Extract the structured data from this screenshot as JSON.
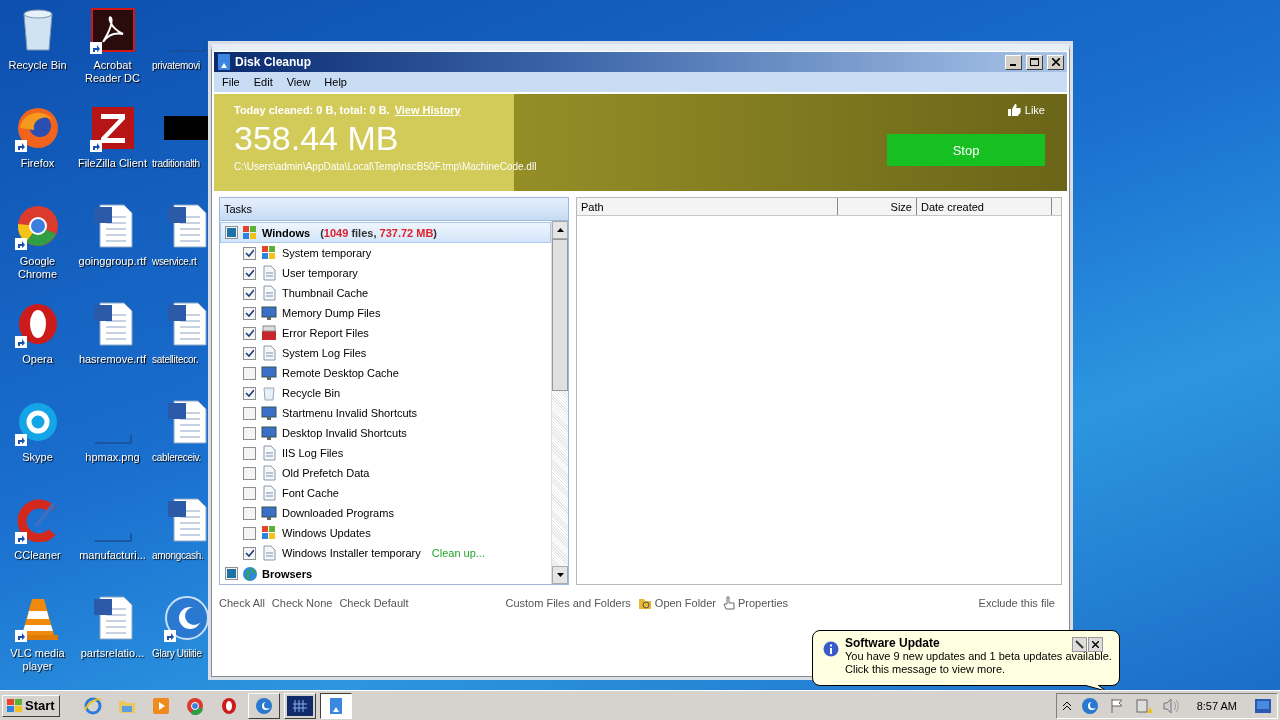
{
  "desktop": {
    "icons": [
      {
        "label": "Recycle Bin",
        "kind": "recycle",
        "shortcut": false
      },
      {
        "label": "Acrobat Reader DC",
        "kind": "acrobat",
        "shortcut": true
      },
      {
        "label": "privatemovi",
        "kind": "blank",
        "shortcut": false
      },
      {
        "label": "Firefox",
        "kind": "firefox",
        "shortcut": true
      },
      {
        "label": "FileZilla Client",
        "kind": "filezilla",
        "shortcut": true
      },
      {
        "label": "traditionalth",
        "kind": "black",
        "shortcut": false
      },
      {
        "label": "Google Chrome",
        "kind": "chrome",
        "shortcut": true
      },
      {
        "label": "goinggroup.rtf",
        "kind": "word",
        "shortcut": false
      },
      {
        "label": "wservice.rt",
        "kind": "word",
        "shortcut": false
      },
      {
        "label": "Opera",
        "kind": "opera",
        "shortcut": true
      },
      {
        "label": "hasremove.rtf",
        "kind": "word",
        "shortcut": false
      },
      {
        "label": "satellitecor.",
        "kind": "word",
        "shortcut": false
      },
      {
        "label": "Skype",
        "kind": "skype",
        "shortcut": true
      },
      {
        "label": "hpmax.png",
        "kind": "blank",
        "shortcut": false
      },
      {
        "label": "cablereceiv.",
        "kind": "word",
        "shortcut": false
      },
      {
        "label": "CCleaner",
        "kind": "ccleaner",
        "shortcut": true
      },
      {
        "label": "manufacturi...",
        "kind": "blank",
        "shortcut": false
      },
      {
        "label": "amongcash.",
        "kind": "word",
        "shortcut": false
      },
      {
        "label": "VLC media player",
        "kind": "vlc",
        "shortcut": true
      },
      {
        "label": "partsrelatio...",
        "kind": "word",
        "shortcut": false
      },
      {
        "label": "Glary Utilitie",
        "kind": "glary",
        "shortcut": true
      }
    ]
  },
  "window": {
    "title": "Disk Cleanup",
    "menu": [
      "File",
      "Edit",
      "View",
      "Help"
    ],
    "banner": {
      "summary": "Today cleaned: 0 B, total: 0 B.",
      "history_link": "View History",
      "size": "358.44 MB",
      "path": "C:\\Users\\admin\\AppData\\Local\\Temp\\nscB50F.tmp\\MachineCode.dll",
      "like": "Like",
      "button": "Stop"
    },
    "tasks": {
      "header": "Tasks",
      "groups": [
        {
          "name": "Windows",
          "kind": "flag",
          "indeterminate": true,
          "selected": true,
          "stats": [
            {
              "text": "(",
              "highlight": false
            },
            {
              "text": "1049",
              "highlight": true
            },
            {
              "text": " files, ",
              "highlight": false
            },
            {
              "text": "737.72 MB",
              "highlight": true
            },
            {
              "text": ")",
              "highlight": false
            }
          ],
          "items": [
            {
              "label": "System temporary",
              "kind": "flag",
              "checked": true
            },
            {
              "label": "User temporary",
              "kind": "document",
              "checked": true
            },
            {
              "label": "Thumbnail Cache",
              "kind": "document",
              "checked": true
            },
            {
              "label": "Memory Dump Files",
              "kind": "monitor",
              "checked": true
            },
            {
              "label": "Error Report Files",
              "kind": "toolbox",
              "checked": true
            },
            {
              "label": "System Log Files",
              "kind": "document",
              "checked": true
            },
            {
              "label": "Remote Desktop Cache",
              "kind": "monitor",
              "checked": false
            },
            {
              "label": "Recycle Bin",
              "kind": "bin",
              "checked": true
            },
            {
              "label": "Startmenu Invalid Shortcuts",
              "kind": "monitor",
              "checked": false
            },
            {
              "label": "Desktop Invalid Shortcuts",
              "kind": "monitor",
              "checked": false
            },
            {
              "label": "IIS Log Files",
              "kind": "document",
              "checked": false
            },
            {
              "label": "Old Prefetch Data",
              "kind": "document",
              "checked": false
            },
            {
              "label": "Font Cache",
              "kind": "document",
              "checked": false
            },
            {
              "label": "Downloaded Programs",
              "kind": "monitor",
              "checked": false
            },
            {
              "label": "Windows Updates",
              "kind": "flag",
              "checked": false
            },
            {
              "label": "Windows Installer temporary",
              "kind": "document",
              "checked": true,
              "note": "Clean up..."
            }
          ]
        },
        {
          "name": "Browsers",
          "kind": "globe",
          "indeterminate": true,
          "selected": false
        }
      ]
    },
    "files": {
      "columns": [
        "Path",
        "Size",
        "Date created"
      ]
    },
    "actions": {
      "left": [
        "Check All",
        "Check None",
        "Check Default"
      ],
      "middle": [
        {
          "label": "Custom Files and Folders",
          "kind": "text"
        },
        {
          "label": "Open Folder",
          "kind": "folder"
        },
        {
          "label": "Properties",
          "kind": "hand"
        }
      ],
      "right": [
        "Exclude this file"
      ]
    }
  },
  "balloon": {
    "title": "Software Update",
    "lines": [
      "You have 9 new updates and 1 beta updates available.",
      "Click this message to view more."
    ]
  },
  "taskbar": {
    "start": "Start",
    "quick_launch": [
      {
        "kind": "ie"
      },
      {
        "kind": "folder"
      },
      {
        "kind": "media"
      },
      {
        "kind": "chrome"
      },
      {
        "kind": "opera"
      }
    ],
    "tasks": [
      {
        "kind": "glary",
        "selected": false
      },
      {
        "kind": "grid",
        "selected": false
      },
      {
        "kind": "cleanup",
        "selected": true
      }
    ],
    "clock": "8:57 AM"
  }
}
